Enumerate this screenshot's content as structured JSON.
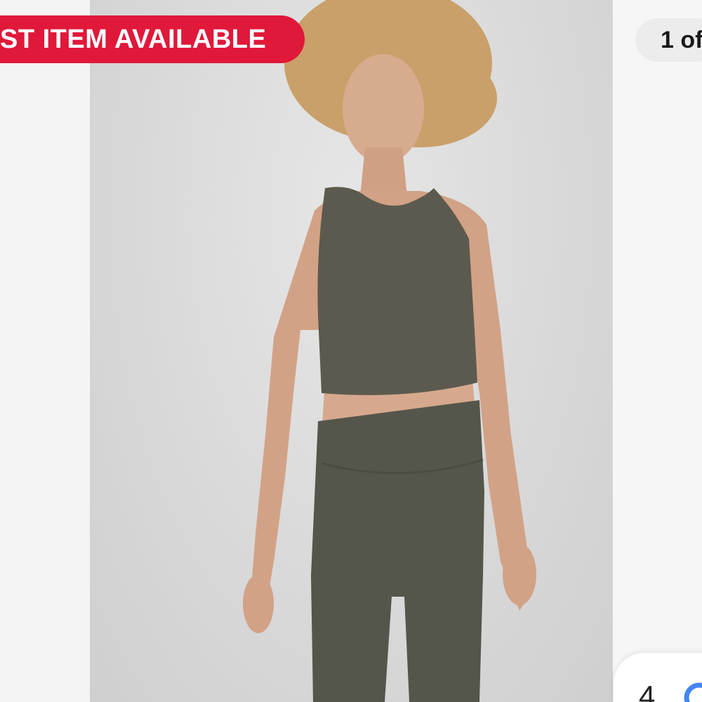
{
  "badge": {
    "text": "ST ITEM AVAILABLE",
    "color": "#e0183a"
  },
  "counter": {
    "text": "1 of"
  },
  "product_image": {
    "alt": "Model wearing olive crop top and leggings",
    "garment_color": "#5b5a4f"
  },
  "fab": {
    "digit": "4",
    "icon": "lens-search-icon"
  }
}
